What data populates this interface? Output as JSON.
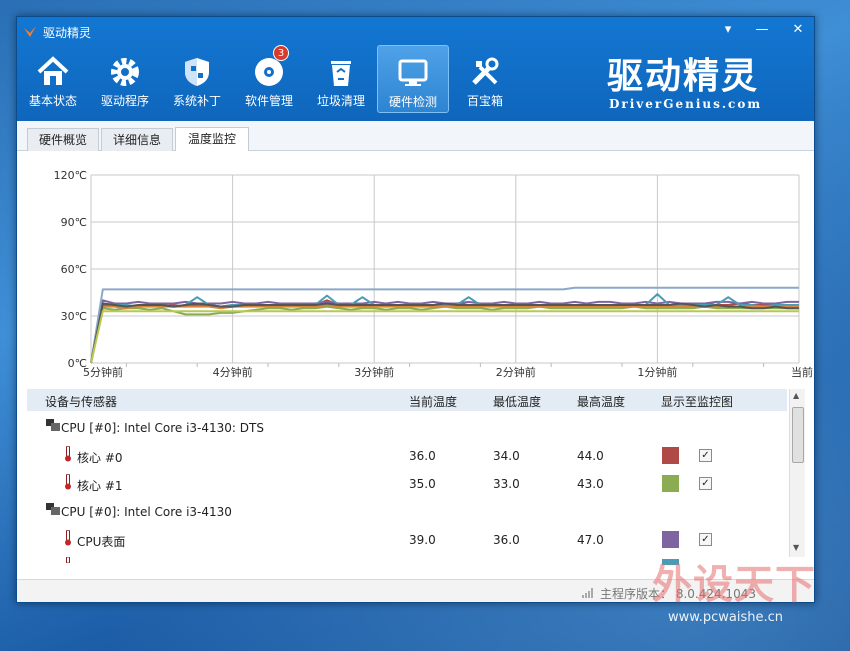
{
  "app": {
    "title": "驱动精灵"
  },
  "window_controls": {
    "menu": "▾",
    "minimize": "—",
    "close": "✕"
  },
  "toolbar": [
    {
      "label": "基本状态",
      "icon": "home-icon"
    },
    {
      "label": "驱动程序",
      "icon": "gear-icon"
    },
    {
      "label": "系统补丁",
      "icon": "shield-icon"
    },
    {
      "label": "软件管理",
      "icon": "disc-icon",
      "badge": "3"
    },
    {
      "label": "垃圾清理",
      "icon": "recycle-bin-icon"
    },
    {
      "label": "硬件检测",
      "icon": "monitor-icon",
      "active": true
    },
    {
      "label": "百宝箱",
      "icon": "tools-icon"
    }
  ],
  "brand": {
    "cn": "驱动精灵",
    "en": "DriverGenius.com"
  },
  "tabs": [
    {
      "label": "硬件概览"
    },
    {
      "label": "详细信息"
    },
    {
      "label": "温度监控",
      "active": true
    }
  ],
  "chart_data": {
    "type": "line",
    "y_ticks": [
      "120℃",
      "90℃",
      "60℃",
      "30℃",
      "0℃"
    ],
    "x_ticks": [
      "5分钟前",
      "4分钟前",
      "3分钟前",
      "2分钟前",
      "1分钟前",
      "当前"
    ],
    "ylim": [
      0,
      120
    ],
    "y_unit": "℃",
    "x": [
      300,
      295,
      290,
      285,
      280,
      275,
      270,
      265,
      260,
      255,
      250,
      245,
      240,
      235,
      230,
      225,
      220,
      215,
      210,
      205,
      200,
      195,
      190,
      185,
      180,
      175,
      170,
      165,
      160,
      155,
      150,
      145,
      140,
      135,
      130,
      125,
      120,
      115,
      110,
      105,
      100,
      95,
      90,
      85,
      80,
      75,
      70,
      65,
      60,
      55,
      50,
      45,
      40,
      35,
      30,
      25,
      20,
      15,
      10,
      5,
      0
    ],
    "series": [
      {
        "color": "#b04a46",
        "values": [
          0,
          37,
          37,
          36,
          36,
          37,
          36,
          37,
          36,
          37,
          37,
          36,
          37,
          36,
          37,
          36,
          37,
          37,
          36,
          37,
          40,
          37,
          37,
          36,
          37,
          37,
          36,
          37,
          37,
          36,
          37,
          38,
          37,
          36,
          37,
          37,
          37,
          36,
          37,
          37,
          37,
          37,
          37,
          36,
          37,
          37,
          37,
          37,
          37,
          37,
          36,
          37,
          38,
          37,
          37,
          38,
          37,
          37,
          37,
          37,
          37
        ]
      },
      {
        "color": "#8cac52",
        "values": [
          0,
          35,
          34,
          35,
          35,
          34,
          35,
          33,
          31,
          31,
          31,
          32,
          32,
          33,
          34,
          35,
          35,
          34,
          35,
          35,
          36,
          35,
          34,
          35,
          35,
          34,
          35,
          35,
          34,
          35,
          36,
          35,
          35,
          35,
          34,
          35,
          35,
          35,
          36,
          35,
          35,
          35,
          35,
          35,
          35,
          35,
          36,
          35,
          35,
          35,
          35,
          35,
          36,
          35,
          35,
          35,
          35,
          35,
          35,
          35,
          35
        ]
      },
      {
        "color": "#7e65a2",
        "values": [
          0,
          40,
          38,
          38,
          39,
          38,
          38,
          38,
          39,
          38,
          38,
          38,
          39,
          38,
          38,
          39,
          38,
          38,
          38,
          38,
          39,
          38,
          38,
          38,
          39,
          38,
          39,
          38,
          38,
          39,
          38,
          38,
          39,
          38,
          38,
          39,
          38,
          38,
          39,
          38,
          38,
          39,
          38,
          39,
          39,
          38,
          38,
          39,
          38,
          39,
          38,
          38,
          38,
          39,
          39,
          38,
          39,
          38,
          38,
          39,
          39
        ]
      },
      {
        "color": "#4b9bb5",
        "values": [
          0,
          38,
          37,
          37,
          36,
          37,
          37,
          36,
          37,
          42,
          37,
          36,
          37,
          37,
          37,
          37,
          36,
          37,
          37,
          37,
          43,
          37,
          37,
          42,
          37,
          36,
          37,
          37,
          36,
          37,
          37,
          37,
          42,
          37,
          37,
          37,
          36,
          37,
          37,
          37,
          37,
          37,
          37,
          37,
          37,
          37,
          37,
          37,
          44,
          37,
          37,
          37,
          37,
          37,
          42,
          37,
          37,
          36,
          37,
          37,
          37
        ]
      },
      {
        "color": "#8aa8c8",
        "values": [
          0,
          47,
          47,
          47,
          47,
          47,
          47,
          47,
          47,
          47,
          47,
          47,
          47,
          47,
          47,
          47,
          47,
          47,
          47,
          47,
          47,
          47,
          47,
          47,
          47,
          47,
          47,
          47,
          47,
          47,
          47,
          47,
          47,
          47,
          47,
          47,
          47,
          47,
          47,
          47,
          47,
          48,
          48,
          48,
          48,
          48,
          48,
          48,
          48,
          48,
          48,
          48,
          48,
          48,
          48,
          48,
          48,
          48,
          48,
          48,
          48
        ]
      },
      {
        "color": "#d8863e",
        "values": [
          0,
          36,
          36,
          35,
          36,
          36,
          36,
          36,
          36,
          36,
          36,
          35,
          36,
          36,
          36,
          36,
          36,
          36,
          36,
          36,
          37,
          36,
          36,
          36,
          36,
          36,
          36,
          36,
          36,
          36,
          36,
          36,
          36,
          36,
          36,
          36,
          36,
          36,
          36,
          36,
          36,
          36,
          36,
          36,
          36,
          36,
          36,
          36,
          36,
          36,
          36,
          36,
          36,
          36,
          36,
          36,
          36,
          36,
          36,
          36,
          36
        ]
      },
      {
        "color": "#555555",
        "values": [
          0,
          38,
          37,
          36,
          37,
          37,
          37,
          36,
          37,
          38,
          37,
          36,
          36,
          37,
          37,
          37,
          37,
          37,
          37,
          37,
          38,
          37,
          37,
          37,
          37,
          37,
          37,
          37,
          37,
          37,
          38,
          37,
          37,
          37,
          37,
          37,
          37,
          37,
          37,
          37,
          37,
          37,
          37,
          37,
          37,
          37,
          37,
          37,
          37,
          37,
          38,
          37,
          36,
          37,
          36,
          36,
          35,
          35,
          36,
          35,
          35
        ]
      },
      {
        "color": "#b8c850",
        "values": [
          0,
          33,
          33,
          33,
          33,
          33,
          33,
          33,
          33,
          33,
          33,
          33,
          33,
          33,
          33,
          33,
          33,
          33,
          33,
          33,
          33,
          33,
          33,
          33,
          33,
          33,
          33,
          33,
          33,
          33,
          33,
          33,
          33,
          33,
          33,
          33,
          33,
          33,
          33,
          33,
          33,
          33,
          33,
          33,
          33,
          33,
          33,
          33,
          33,
          33,
          33,
          33,
          33,
          33,
          33,
          33,
          33,
          33,
          33,
          33,
          33
        ]
      }
    ]
  },
  "table": {
    "headers": [
      "设备与传感器",
      "当前温度",
      "最低温度",
      "最高温度",
      "显示至监控图"
    ],
    "groups": [
      {
        "name": "CPU [#0]: Intel Core i3-4130: DTS",
        "rows": [
          {
            "name": "核心 #0",
            "current": "36.0",
            "min": "34.0",
            "max": "44.0",
            "color": "#b04a46",
            "checked": "✓"
          },
          {
            "name": "核心 #1",
            "current": "35.0",
            "min": "33.0",
            "max": "43.0",
            "color": "#8cac52",
            "checked": "✓"
          }
        ]
      },
      {
        "name": "CPU [#0]: Intel Core i3-4130",
        "rows": [
          {
            "name": "CPU表面",
            "current": "39.0",
            "min": "36.0",
            "max": "47.0",
            "color": "#7e65a2",
            "checked": "✓"
          }
        ]
      }
    ],
    "partial_swatch_color": "#4b9bb5"
  },
  "status": {
    "version": "主程序版本：  8.0.424.1043"
  },
  "watermark": {
    "cn": "外设天下",
    "en": "www.pcwaishe.cn"
  }
}
